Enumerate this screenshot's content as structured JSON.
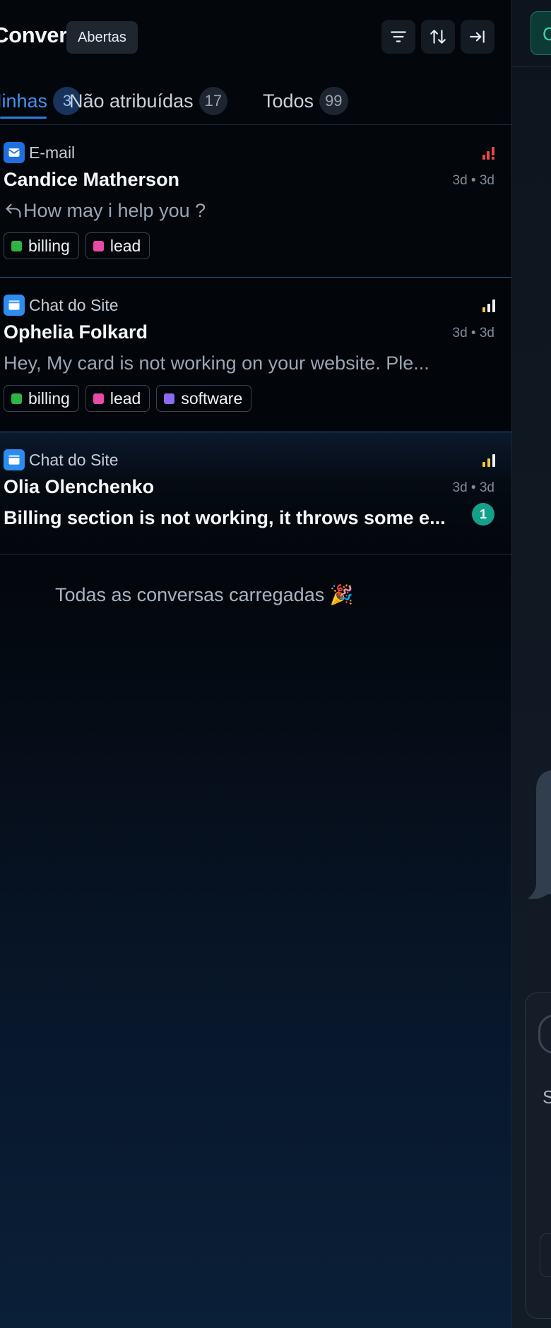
{
  "header": {
    "title": "Conversas",
    "status_filter": "Abertas",
    "filter_icon": "filter-icon",
    "sort_icon": "sort-icon",
    "collapse_icon": "collapse-panel-icon"
  },
  "tabs": [
    {
      "label": "Minhas",
      "count": "3",
      "active": true
    },
    {
      "label": "Não atribuídas",
      "count": "17",
      "active": false
    },
    {
      "label": "Todos",
      "count": "99",
      "active": false
    }
  ],
  "conversations": [
    {
      "inbox": "E-mail",
      "inbox_icon": "email-icon",
      "name": "Candice Matherson",
      "time": "3d • 3d",
      "message": "How may i help you ?",
      "message_icon": "reply-icon",
      "priority": "urgent",
      "priority_color": "#e5484d",
      "labels": [
        {
          "name": "billing",
          "color": "#2fb344"
        },
        {
          "name": "lead",
          "color": "#e84aa6"
        }
      ]
    },
    {
      "inbox": "Chat do Site",
      "inbox_icon": "website-icon",
      "name": "Ophelia Folkard",
      "time": "3d • 3d",
      "message": "Hey, My card is not working on your website. Ple...",
      "priority": "low",
      "priority_color": "#f5c542",
      "labels": [
        {
          "name": "billing",
          "color": "#2fb344"
        },
        {
          "name": "lead",
          "color": "#e84aa6"
        },
        {
          "name": "software",
          "color": "#8b6cf0"
        }
      ]
    },
    {
      "inbox": "Chat do Site",
      "inbox_icon": "website-icon",
      "name": "Olia Olenchenko",
      "time": "3d • 3d",
      "message": "Billing section is not working, it throws some e...",
      "priority": "medium",
      "priority_color": "#f5c542",
      "unread_count": "1",
      "labels": []
    }
  ],
  "footer": {
    "all_loaded": "Todas as conversas carregadas 🎉"
  },
  "right_panel": {
    "button_text": "C",
    "text_fragment": "S"
  }
}
